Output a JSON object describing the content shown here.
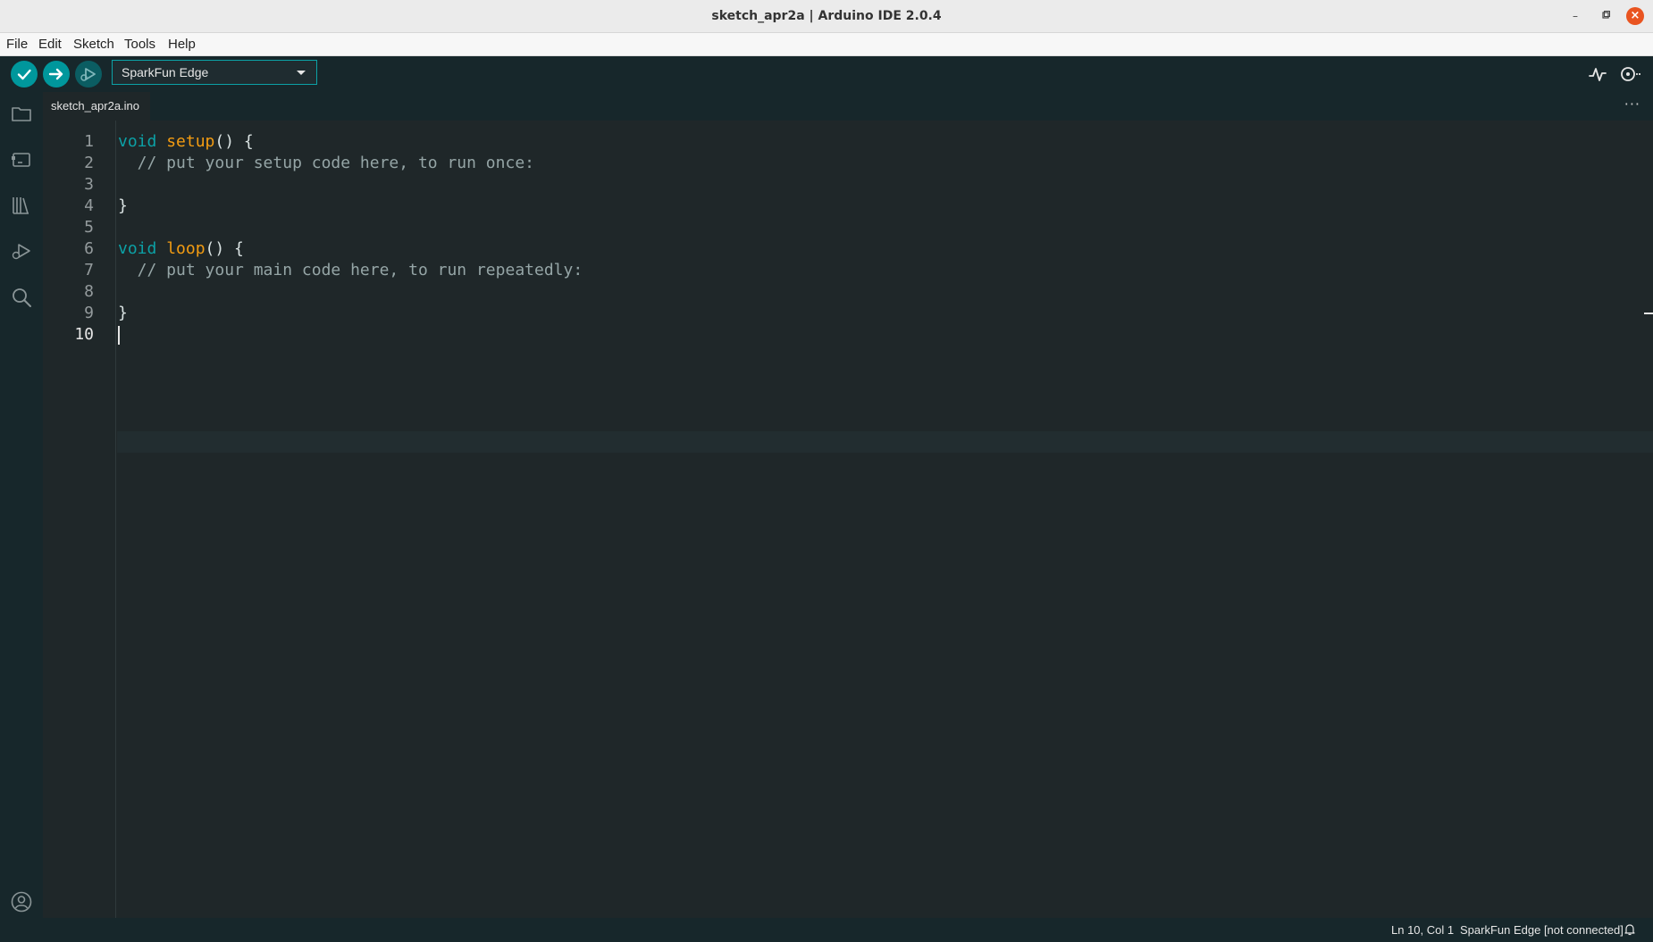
{
  "window": {
    "title": "sketch_apr2a | Arduino IDE 2.0.4"
  },
  "menu": [
    "File",
    "Edit",
    "Sketch",
    "Tools",
    "Help"
  ],
  "toolbar": {
    "board": "SparkFun Edge"
  },
  "tab": {
    "filename": "sketch_apr2a.ino"
  },
  "editor": {
    "line_numbers": [
      "1",
      "2",
      "3",
      "4",
      "5",
      "6",
      "7",
      "8",
      "9",
      "10"
    ],
    "lines": [
      {
        "kw": "void ",
        "fn": "setup",
        "rest": "() {"
      },
      {
        "comment": "  // put your setup code here, to run once:"
      },
      {
        "text": ""
      },
      {
        "text": "}"
      },
      {
        "text": ""
      },
      {
        "kw": "void ",
        "fn": "loop",
        "rest": "() {"
      },
      {
        "comment": "  // put your main code here, to run repeatedly:"
      },
      {
        "text": ""
      },
      {
        "text": "}"
      },
      {
        "text": ""
      }
    ]
  },
  "status": {
    "cursor": "Ln 10, Col 1",
    "board_status": "SparkFun Edge [not connected]"
  },
  "colors": {
    "accent": "#00979c",
    "keyword": "#0ca1a6",
    "function": "#f39c12",
    "comment": "#95a5a6",
    "background": "#1f2729"
  },
  "icons": {
    "window": [
      "minimize-icon",
      "restore-icon",
      "close-icon"
    ],
    "toolbar": [
      "verify-icon",
      "upload-icon",
      "debug-icon",
      "serial-plotter-icon",
      "serial-monitor-icon"
    ],
    "sidebar": [
      "sketchbook-folder-icon",
      "boards-manager-icon",
      "library-manager-icon",
      "debug-icon",
      "search-icon",
      "profile-icon"
    ],
    "status": "notification-bell-icon"
  }
}
